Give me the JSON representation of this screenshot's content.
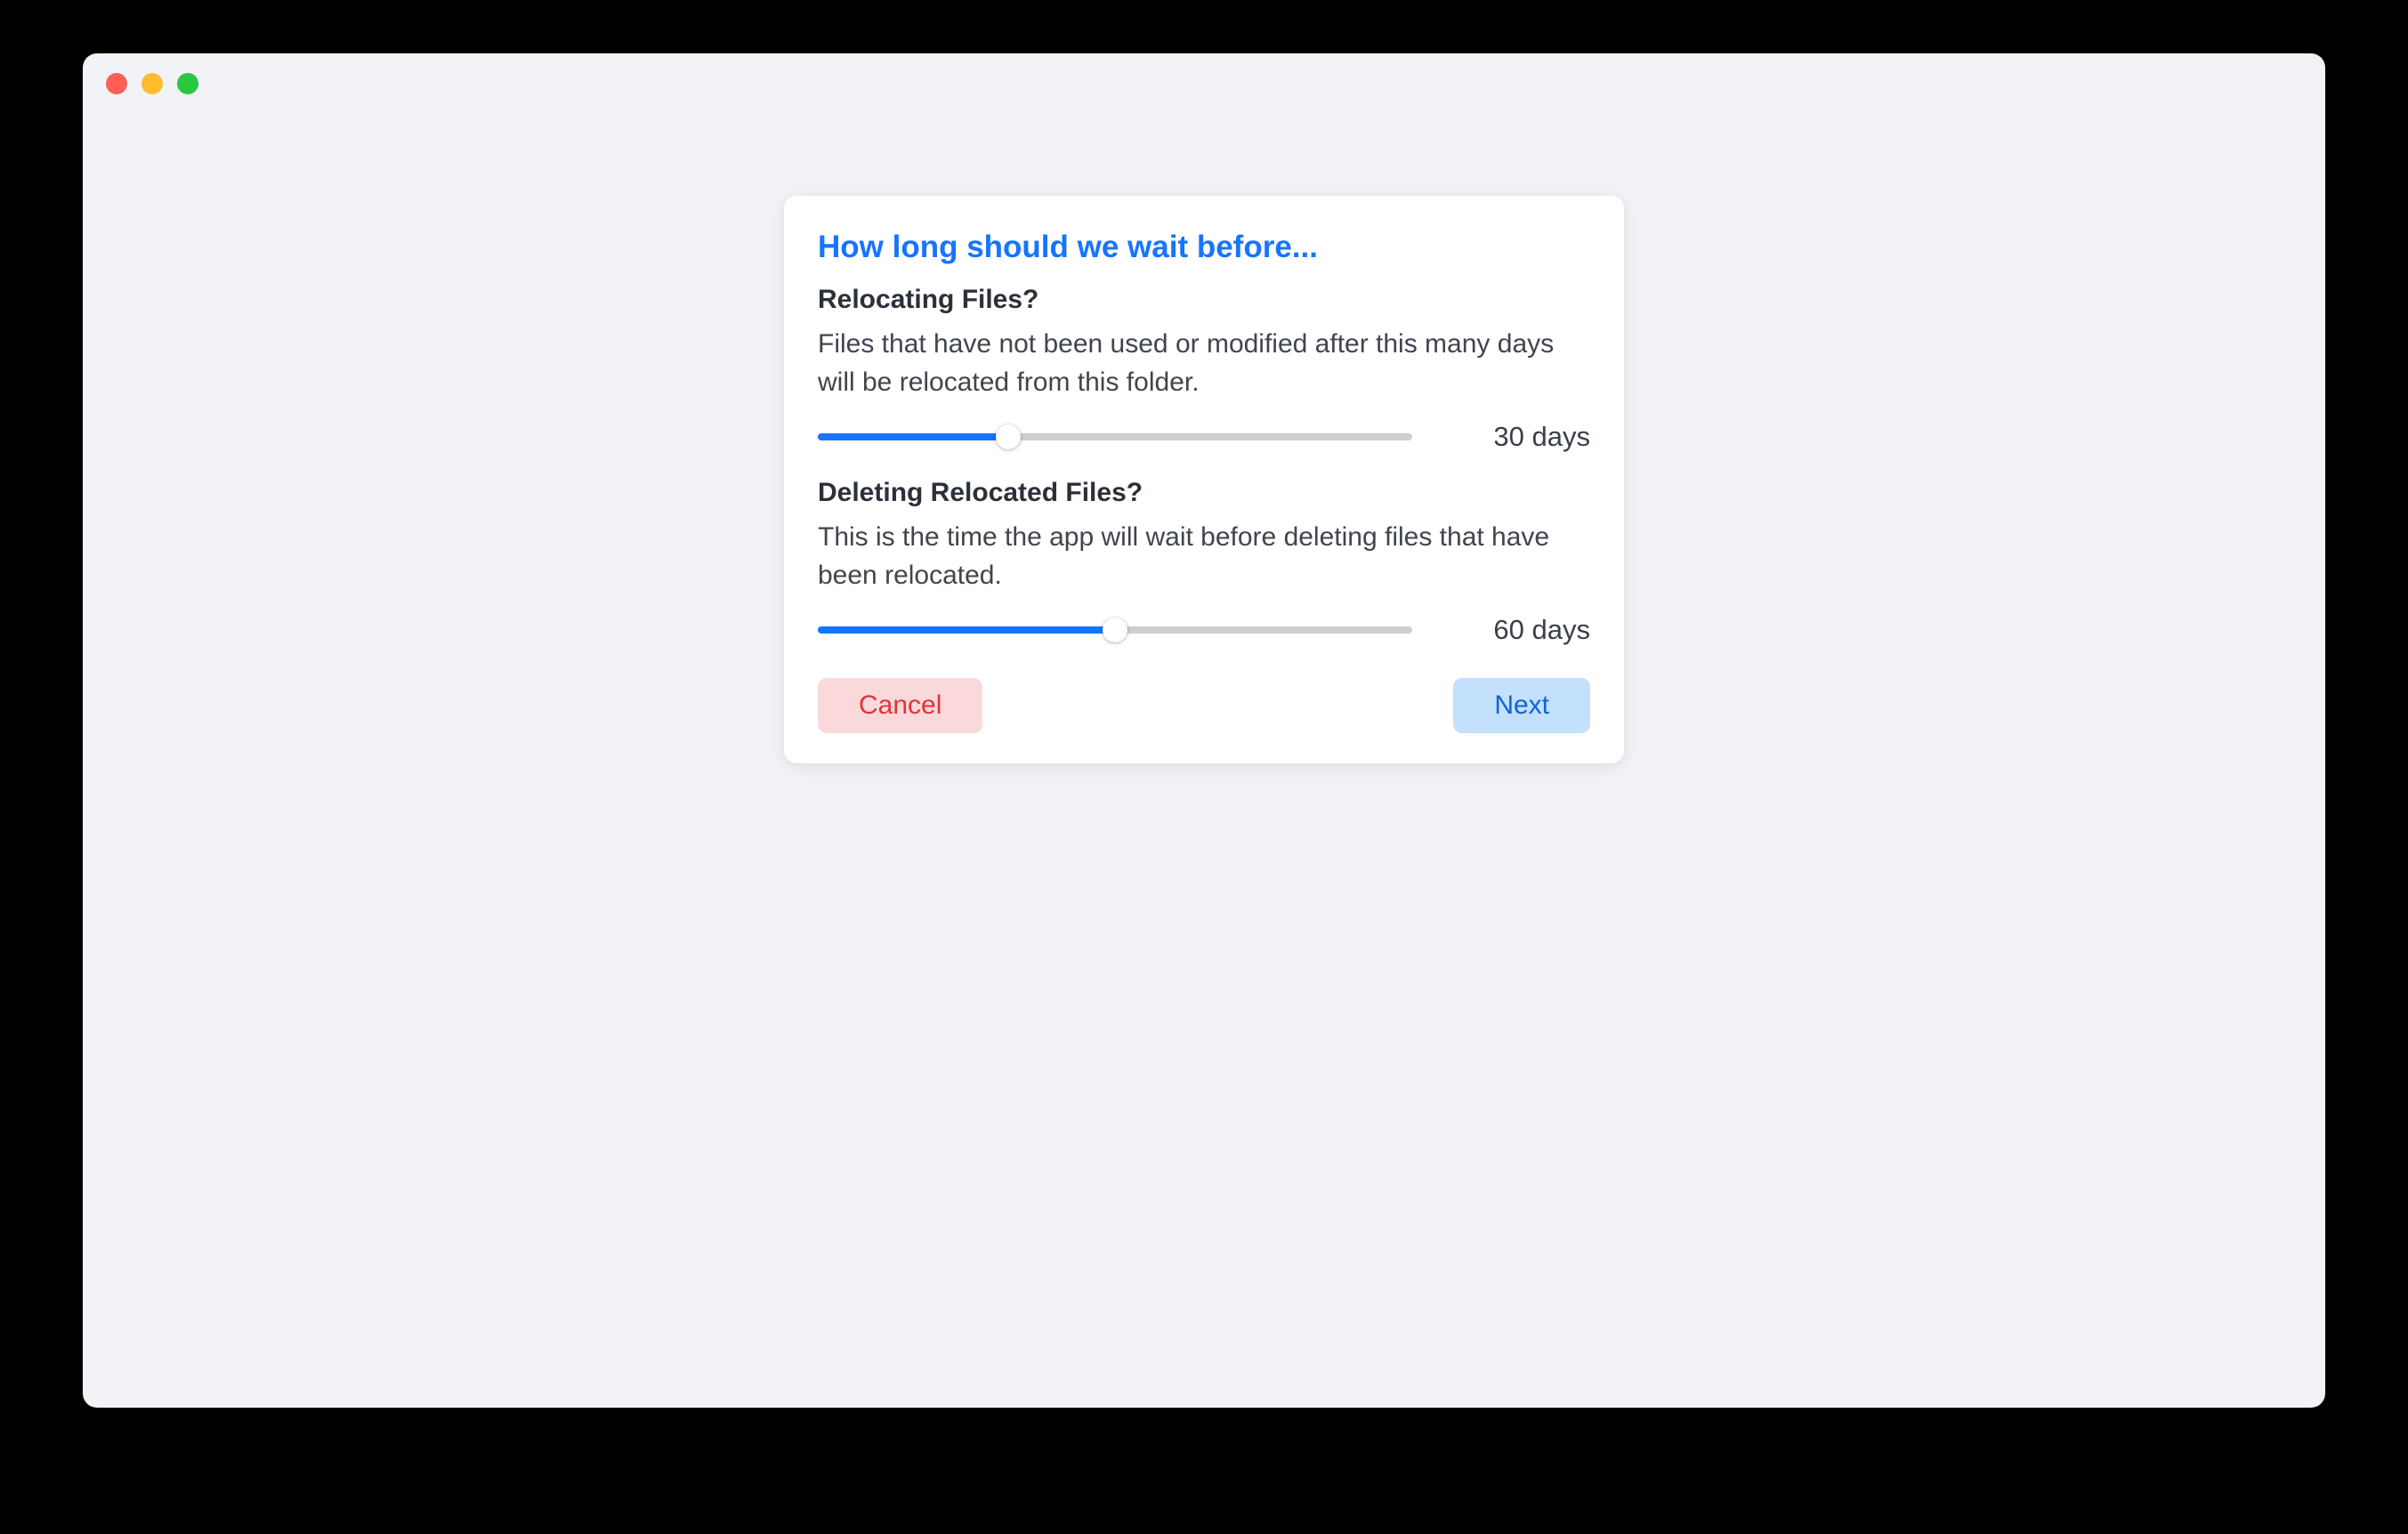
{
  "dialog": {
    "title": "How long should we wait before...",
    "sections": [
      {
        "heading": "Relocating Files?",
        "description": "Files that have not been used or modified after this many days will be relocated from this folder.",
        "value_label": "30 days",
        "value": 30,
        "max": 100
      },
      {
        "heading": "Deleting Relocated Files?",
        "description": "This is the time the app will wait before deleting files that have been relocated.",
        "value_label": "60 days",
        "value": 60,
        "max": 120
      }
    ],
    "buttons": {
      "cancel": "Cancel",
      "next": "Next"
    }
  },
  "slider_fill_percent": {
    "relocate": 32,
    "delete": 50
  }
}
